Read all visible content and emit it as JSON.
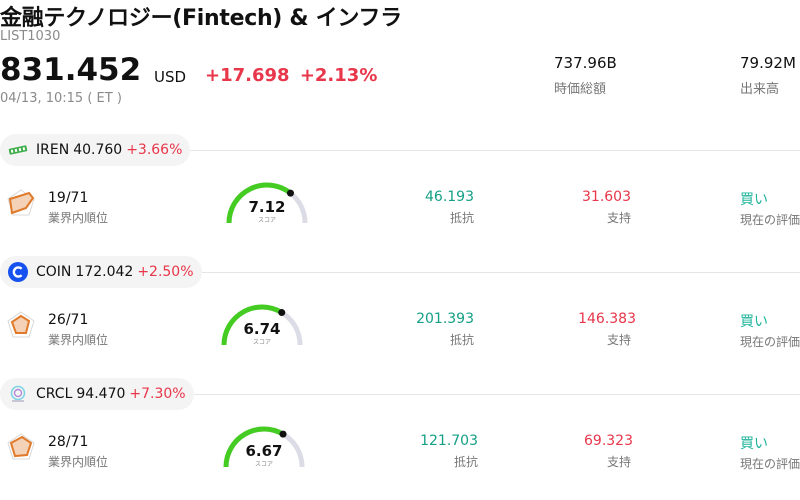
{
  "header": {
    "title": "金融テクノロジー(Fintech) & インフラ",
    "code": "LIST1030",
    "price": "831.452",
    "currency": "USD",
    "change": "+17.698",
    "change_pct": "+2.13%",
    "timestamp": "04/13, 10:15 ( ET )"
  },
  "stats": [
    {
      "value": "737.96B",
      "label": "時価総額"
    },
    {
      "value": "79.92M",
      "label": "出来高"
    }
  ],
  "labels": {
    "rank": "業界内順位",
    "score": "スコア",
    "resistance": "抵抗",
    "support": "支持",
    "evaluation": "現在の評価"
  },
  "stocks": [
    {
      "ticker": "IREN",
      "price": "40.760",
      "change_pct": "+3.66%",
      "rank": "19/71",
      "score": "7.12",
      "score_fraction": 0.712,
      "resistance": "46.193",
      "support": "31.603",
      "rating": "買い",
      "logo": "iren-logo"
    },
    {
      "ticker": "COIN",
      "price": "172.042",
      "change_pct": "+2.50%",
      "rank": "26/71",
      "score": "6.74",
      "score_fraction": 0.674,
      "resistance": "201.393",
      "support": "146.383",
      "rating": "買い",
      "logo": "coinbase-logo"
    },
    {
      "ticker": "CRCL",
      "price": "94.470",
      "change_pct": "+7.30%",
      "rank": "28/71",
      "score": "6.67",
      "score_fraction": 0.667,
      "resistance": "121.703",
      "support": "69.323",
      "rating": "買い",
      "logo": "circle-logo"
    }
  ],
  "colors": {
    "up": "#e8364a",
    "resistance": "#14a085",
    "rating": "#1db49a",
    "gauge_fill": "#44cc22",
    "gauge_track": "#dcdce6",
    "radar_stroke": "#e07a2a"
  }
}
